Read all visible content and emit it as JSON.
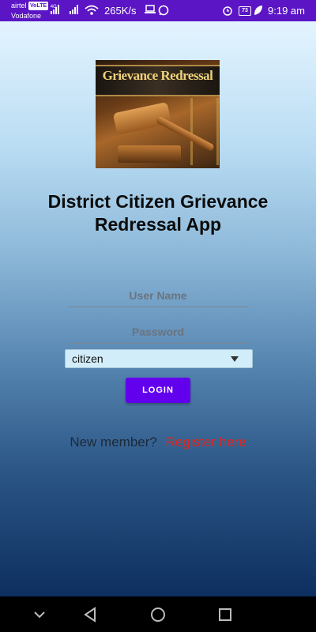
{
  "status_bar": {
    "carrier1": "airtel",
    "volte": "VoLTE",
    "carrier2": "Vodafone",
    "speed": "265K/s",
    "battery": "73",
    "time": "9:19 am",
    "bg_color": "#5b15c4"
  },
  "logo": {
    "title": "Grievance Redressal"
  },
  "app": {
    "title_line1": "District Citizen Grievance",
    "title_line2": "Redressal App"
  },
  "form": {
    "username_placeholder": "User Name",
    "password_placeholder": "Password",
    "user_type": "citizen",
    "login_label": "LOGIN",
    "new_member": "New member?",
    "register": "Register here",
    "accent_color": "#6200ee",
    "register_color": "#e0261e"
  }
}
